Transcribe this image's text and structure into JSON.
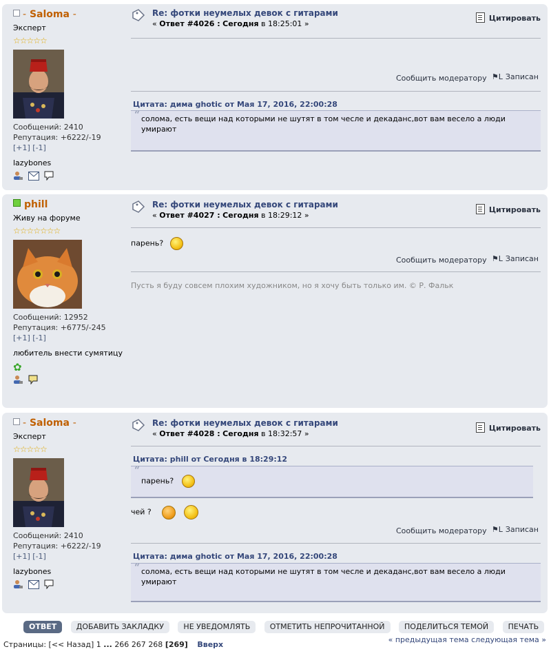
{
  "posts": [
    {
      "poster": {
        "name": "Saloma",
        "rank": "Эксперт",
        "stars": "☆☆☆☆☆",
        "posts": "Сообщений: 2410",
        "rep": "Репутация: +6222/-19",
        "karma": "[+1] [-1]",
        "blurb": "lazybones"
      },
      "subject": "Re: фотки неумелых девок с гитарами",
      "meta": {
        "prefix": "« ",
        "reply": "Ответ #4026 :",
        "date": "Сегодня",
        "time": " в 18:25:01 »"
      },
      "quote_label": "Цитировать",
      "report": "Сообщить модератору",
      "logged": "Записан",
      "quote": {
        "header": "Цитата: дима ghotic от Мая 17, 2016, 22:00:28",
        "text": "солома, есть вещи над которыми не шутят в том чесле и декаданс,вот вам весело а люди умирают"
      }
    },
    {
      "poster": {
        "name": "phill",
        "rank": "Живу на форуме",
        "stars": "☆☆☆☆☆☆☆",
        "posts": "Сообщений: 12952",
        "rep": "Репутация: +6775/-245",
        "karma": "[+1] [-1]",
        "blurb": "любитель внести сумятицу"
      },
      "subject": "Re: фотки неумелых девок с гитарами",
      "meta": {
        "prefix": "« ",
        "reply": "Ответ #4027 :",
        "date": "Сегодня",
        "time": " в 18:29:12 »"
      },
      "quote_label": "Цитировать",
      "body": "парень?",
      "report": "Сообщить модератору",
      "logged": "Записан",
      "signature": "Пусть я буду совсем плохим художником, но я хочу быть только им. © Р. Фальк"
    },
    {
      "poster": {
        "name": "Saloma",
        "rank": "Эксперт",
        "stars": "☆☆☆☆☆",
        "posts": "Сообщений: 2410",
        "rep": "Репутация: +6222/-19",
        "karma": "[+1] [-1]",
        "blurb": "lazybones"
      },
      "subject": "Re: фотки неумелых девок с гитарами",
      "meta": {
        "prefix": "« ",
        "reply": "Ответ #4028 :",
        "date": "Сегодня",
        "time": " в 18:32:57 »"
      },
      "quote_label": "Цитировать",
      "quote1": {
        "header": "Цитата: phill от Сегодня в 18:29:12",
        "text": "парень?"
      },
      "body": "чей ?",
      "report": "Сообщить модератору",
      "logged": "Записан",
      "quote2": {
        "header": "Цитата: дима ghotic от Мая 17, 2016, 22:00:28",
        "text": "солома, есть вещи над которыми не шутят в том чесле и декаданс,вот вам весело а люди умирают"
      }
    }
  ],
  "actions": [
    "ОТВЕТ",
    "ДОБАВИТЬ ЗАКЛАДКУ",
    "НЕ УВЕДОМЛЯТЬ",
    "ОТМЕТИТЬ НЕПРОЧИТАННОЙ",
    "ПОДЕЛИТЬСЯ ТЕМОЙ",
    "ПЕЧАТЬ"
  ],
  "pagination": {
    "label": "Страницы:",
    "back": "[<< Назад]",
    "first": "1",
    "dots": "...",
    "p1": "266",
    "p2": "267",
    "p3": "268",
    "current": "[269]",
    "top": "Вверх"
  },
  "prevnext": "« предыдущая тема следующая тема »"
}
